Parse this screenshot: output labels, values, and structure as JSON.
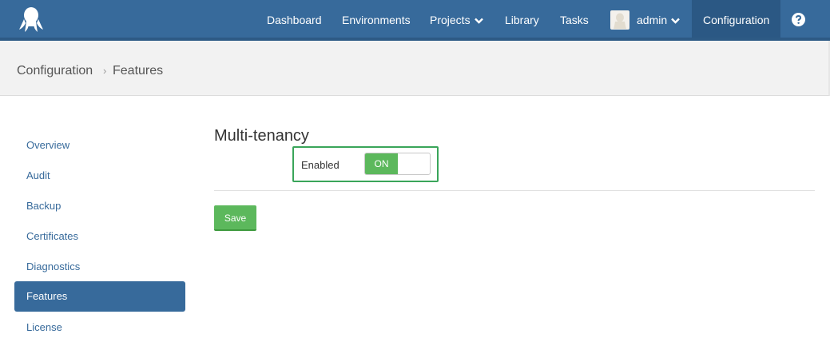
{
  "nav": {
    "items": [
      {
        "label": "Dashboard"
      },
      {
        "label": "Environments"
      },
      {
        "label": "Projects"
      },
      {
        "label": "Library"
      },
      {
        "label": "Tasks"
      }
    ],
    "user": "admin",
    "active": "Configuration",
    "help_icon": "question-circle-icon",
    "logo_icon": "octopus-logo"
  },
  "breadcrumb": {
    "parent": "Configuration",
    "current": "Features"
  },
  "sidebar": {
    "items": [
      {
        "label": "Overview"
      },
      {
        "label": "Audit"
      },
      {
        "label": "Backup"
      },
      {
        "label": "Certificates"
      },
      {
        "label": "Diagnostics"
      },
      {
        "label": "Features"
      },
      {
        "label": "License"
      }
    ],
    "active": "Features"
  },
  "main": {
    "section_title": "Multi-tenancy",
    "field_label": "Enabled",
    "toggle_label": "ON",
    "toggle_state": true,
    "save_label": "Save"
  },
  "colors": {
    "nav_bg": "#376a9b",
    "nav_active_bg": "#2b5884",
    "accent": "#5cb85c",
    "highlight_border": "#3aa55a"
  }
}
